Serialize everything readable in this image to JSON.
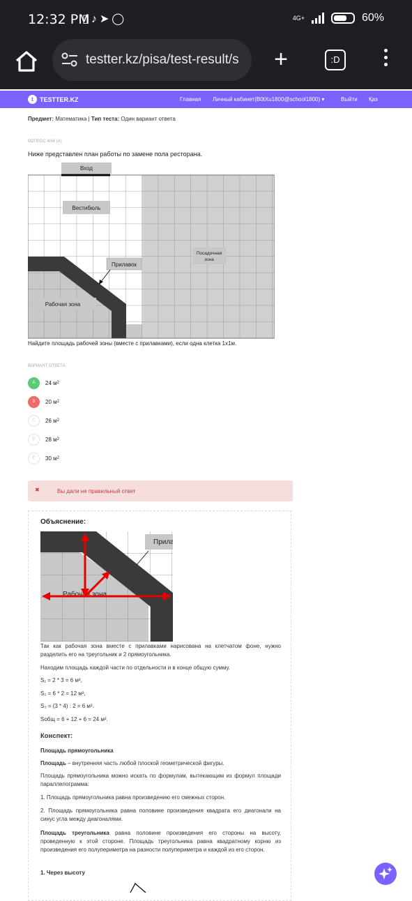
{
  "status": {
    "time": "12:32 PM",
    "network": "4G+",
    "battery": "60%"
  },
  "browser": {
    "url": "testter.kz/pisa/test-result/s"
  },
  "nav": {
    "logo": "TESTTER.KZ",
    "items": [
      "Главная",
      "Личный кабинет(B0tXu1800@school1800) ▾",
      "Выйти",
      "Қаз"
    ]
  },
  "meta": {
    "subject_label": "Предмет:",
    "subject": "Математика",
    "type_label": "Тип теста:",
    "type": "Один вариант ответа"
  },
  "question": {
    "number": "ВОПРОС 4/84 (A)",
    "text": "Ниже представлен план работы по замене пола ресторана.",
    "labels": {
      "entrance": "Вход",
      "lobby": "Вестибюль",
      "counter": "Прилавок",
      "seating_1": "Посадочная",
      "seating_2": "зона",
      "work": "Рабочая зона"
    },
    "prompt": "Найдите площадь рабочей зоны (вместе с прилавками), если одна клетка 1x1м."
  },
  "answers_label": "ВАРИАНТ ОТВЕТА",
  "answers": [
    {
      "letter": "A",
      "value": "24 м",
      "state": "correct"
    },
    {
      "letter": "B",
      "value": "20 м",
      "state": "wrong"
    },
    {
      "letter": "C",
      "value": "26 м",
      "state": "none"
    },
    {
      "letter": "D",
      "value": "28 м",
      "state": "none"
    },
    {
      "letter": "E",
      "value": "30 м",
      "state": "none"
    }
  ],
  "result": {
    "icon": "✖",
    "text": "Вы дали не правильный ответ"
  },
  "explanation": {
    "title": "Объяснение:",
    "img_label_counter": "Прила",
    "img_label_work": "Рабочая зона",
    "p1": "Так как рабочая зона вместе с прилавками нарисована на клетчатом фоне, нужно разделить его на треугольник и 2 прямоугольника.",
    "p2": "Находим площадь каждой части по отдельности и в конце общую сумму.",
    "s1": "S₁ = 2 * 3 = 6 м²,",
    "s2": "S₂ = 6 * 2 = 12 м²,",
    "s3": "S₃ = (3 * 4) : 2 = 6 м².",
    "s4": "Sобщ = 6 + 12 + 6 = 24 м².",
    "konspekt": "Конспект:",
    "h1": "Площадь прямоугольника",
    "def_bold": "Площадь",
    "def_rest": " – внутренняя часть любой плоской геометрической фигуры.",
    "p3": "Площадь прямоугольника можно искать по формулам, вытекающим из формул площади параллелограмма:",
    "p4": "1. Площадь прямоугольника равна произведению его смежных сторон.",
    "p5": "2. Площадь прямоугольника равна половине произведения квадрата его диагонали на синус угла между диагоналями.",
    "tri_bold": "Площадь треугольника",
    "tri_rest": " равна половине произведения его стороны на высоту, проведенную к этой стороне. Площадь треугольника равна квадратному корню из произведения его полупериметра на разности полупериметра и каждой из его сторон.",
    "h2": "1. Через высоту"
  }
}
